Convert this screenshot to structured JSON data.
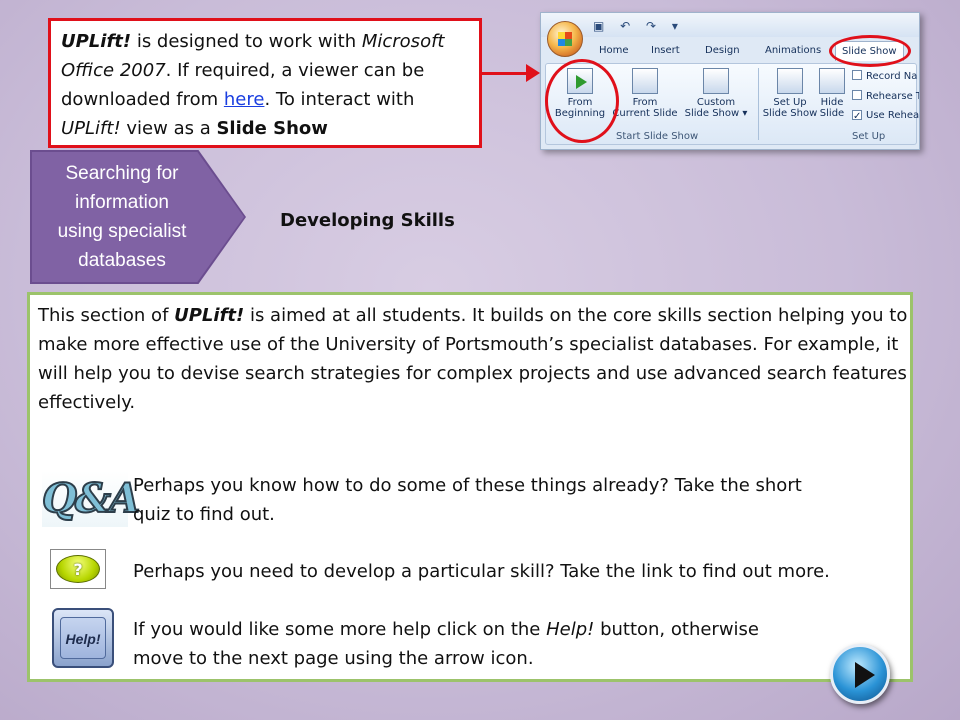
{
  "info": {
    "brand": "UPLift!",
    "text1": " is designed to work with ",
    "office": "Microsoft Office 2007",
    "text2": ".  If required, a viewer can be downloaded from ",
    "link": "here",
    "text3": ". To interact with ",
    "brand2": "UPLift!",
    "text4": "  view as a ",
    "slideshow": "Slide Show"
  },
  "ribbon": {
    "tabs": [
      "Home",
      "Insert",
      "Design",
      "Animations",
      "Slide Show"
    ],
    "buttons": [
      {
        "line1": "From",
        "line2": "Beginning"
      },
      {
        "line1": "From",
        "line2": "Current Slide"
      },
      {
        "line1": "Custom",
        "line2": "Slide Show ▾"
      },
      {
        "line1": "Set Up",
        "line2": "Slide Show"
      },
      {
        "line1": "Hide",
        "line2": "Slide"
      }
    ],
    "group1": "Start Slide Show",
    "group2": "Set Up",
    "small": [
      "Record Na",
      "Rehearse T",
      "Use Rehea"
    ]
  },
  "nav": {
    "section": [
      "Searching for",
      "information",
      "using specialist",
      "databases"
    ],
    "heading": "Developing Skills"
  },
  "main": {
    "intro_pre": "This section of ",
    "intro_brand": "UPLift!",
    "intro_post": " is aimed at all students.  It builds on the core skills section helping you to make more effective use of the University of Portsmouth’s specialist databases.  For example, it will help you to devise search strategies for complex projects and use advanced search features effectively.",
    "qa_logo": "Q&A",
    "qa_line1": "Perhaps you know how to do some of these things already?  Take the short",
    "qa_line2": "quiz to find out.",
    "skill_line": "Perhaps you need to develop a particular skill?  Take the link to find out more.",
    "help_pre": "If you would like some more help click on the ",
    "help_em": "Help!",
    "help_post": " button, otherwise",
    "help_line2": "move to the next page using the arrow icon.",
    "help_button": "Help!",
    "question_mark": "?"
  }
}
